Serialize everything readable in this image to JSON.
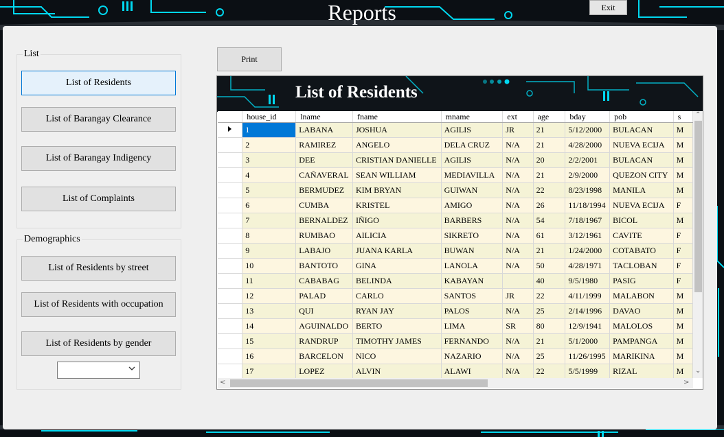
{
  "window": {
    "title": "Reports",
    "exit_label": "Exit"
  },
  "list_group": {
    "title": "List",
    "buttons": [
      "List of Residents",
      "List of Barangay Clearance",
      "List of Barangay Indigency",
      "List of Complaints"
    ]
  },
  "demographics_group": {
    "title": "Demographics",
    "buttons": [
      "List of Residents by street",
      "List of Residents with occupation",
      "List of Residents by gender"
    ],
    "gender_select_value": ""
  },
  "toolbar": {
    "print_label": "Print"
  },
  "report": {
    "title": "List of Residents",
    "columns": [
      "house_id",
      "lname",
      "fname",
      "mname",
      "ext",
      "age",
      "bday",
      "pob",
      "s"
    ],
    "rows": [
      [
        "1",
        "LABANA",
        "JOSHUA",
        "AGILIS",
        "JR",
        "21",
        "5/12/2000",
        "BULACAN",
        "M"
      ],
      [
        "2",
        "RAMIREZ",
        "ANGELO",
        "DELA CRUZ",
        "N/A",
        "21",
        "4/28/2000",
        "NUEVA ECIJA",
        "M"
      ],
      [
        "3",
        "DEE",
        "CRISTIAN DANIELLE",
        "AGILIS",
        "N/A",
        "20",
        "2/2/2001",
        "BULACAN",
        "M"
      ],
      [
        "4",
        "CAÑAVERAL",
        "SEAN WILLIAM",
        "MEDIAVILLA",
        "N/A",
        "21",
        "2/9/2000",
        "QUEZON CITY",
        "M"
      ],
      [
        "5",
        "BERMUDEZ",
        "KIM BRYAN",
        "GUIWAN",
        "N/A",
        "22",
        "8/23/1998",
        "MANILA",
        "M"
      ],
      [
        "6",
        "CUMBA",
        "KRISTEL",
        "AMIGO",
        "N/A",
        "26",
        "11/18/1994",
        "NUEVA ECIJA",
        "F"
      ],
      [
        "7",
        "BERNALDEZ",
        "IÑIGO",
        "BARBERS",
        "N/A",
        "54",
        "7/18/1967",
        "BICOL",
        "M"
      ],
      [
        "8",
        "RUMBAO",
        "AILICIA",
        "SIKRETO",
        "N/A",
        "61",
        "3/12/1961",
        "CAVITE",
        "F"
      ],
      [
        "9",
        "LABAJO",
        "JUANA KARLA",
        "BUWAN",
        "N/A",
        "21",
        "1/24/2000",
        "COTABATO",
        "F"
      ],
      [
        "10",
        "BANTOTO",
        "GINA",
        "LANOLA",
        "N/A",
        "50",
        "4/28/1971",
        "TACLOBAN",
        "F"
      ],
      [
        "11",
        "CABABAG",
        "BELINDA",
        "KABAYAN",
        "",
        "40",
        "9/5/1980",
        "PASIG",
        "F"
      ],
      [
        "12",
        "PALAD",
        "CARLO",
        "SANTOS",
        "JR",
        "22",
        "4/11/1999",
        "MALABON",
        "M"
      ],
      [
        "13",
        "QUI",
        "RYAN JAY",
        "PALOS",
        "N/A",
        "25",
        "2/14/1996",
        "DAVAO",
        "M"
      ],
      [
        "14",
        "AGUINALDO",
        "BERTO",
        "LIMA",
        "SR",
        "80",
        "12/9/1941",
        "MALOLOS",
        "M"
      ],
      [
        "15",
        "RANDRUP",
        "TIMOTHY JAMES",
        "FERNANDO",
        "N/A",
        "21",
        "5/1/2000",
        "PAMPANGA",
        "M"
      ],
      [
        "16",
        "BARCELON",
        "NICO",
        "NAZARIO",
        "N/A",
        "25",
        "11/26/1995",
        "MARIKINA",
        "M"
      ],
      [
        "17",
        "LOPEZ",
        "ALVIN",
        "ALAWI",
        "N/A",
        "22",
        "5/5/1999",
        "RIZAL",
        "M"
      ]
    ]
  },
  "colors": {
    "accent": "#00e5ff",
    "selected": "#0078d7",
    "row_a": "#f5f3d6",
    "row_b": "#fdf6e0"
  }
}
